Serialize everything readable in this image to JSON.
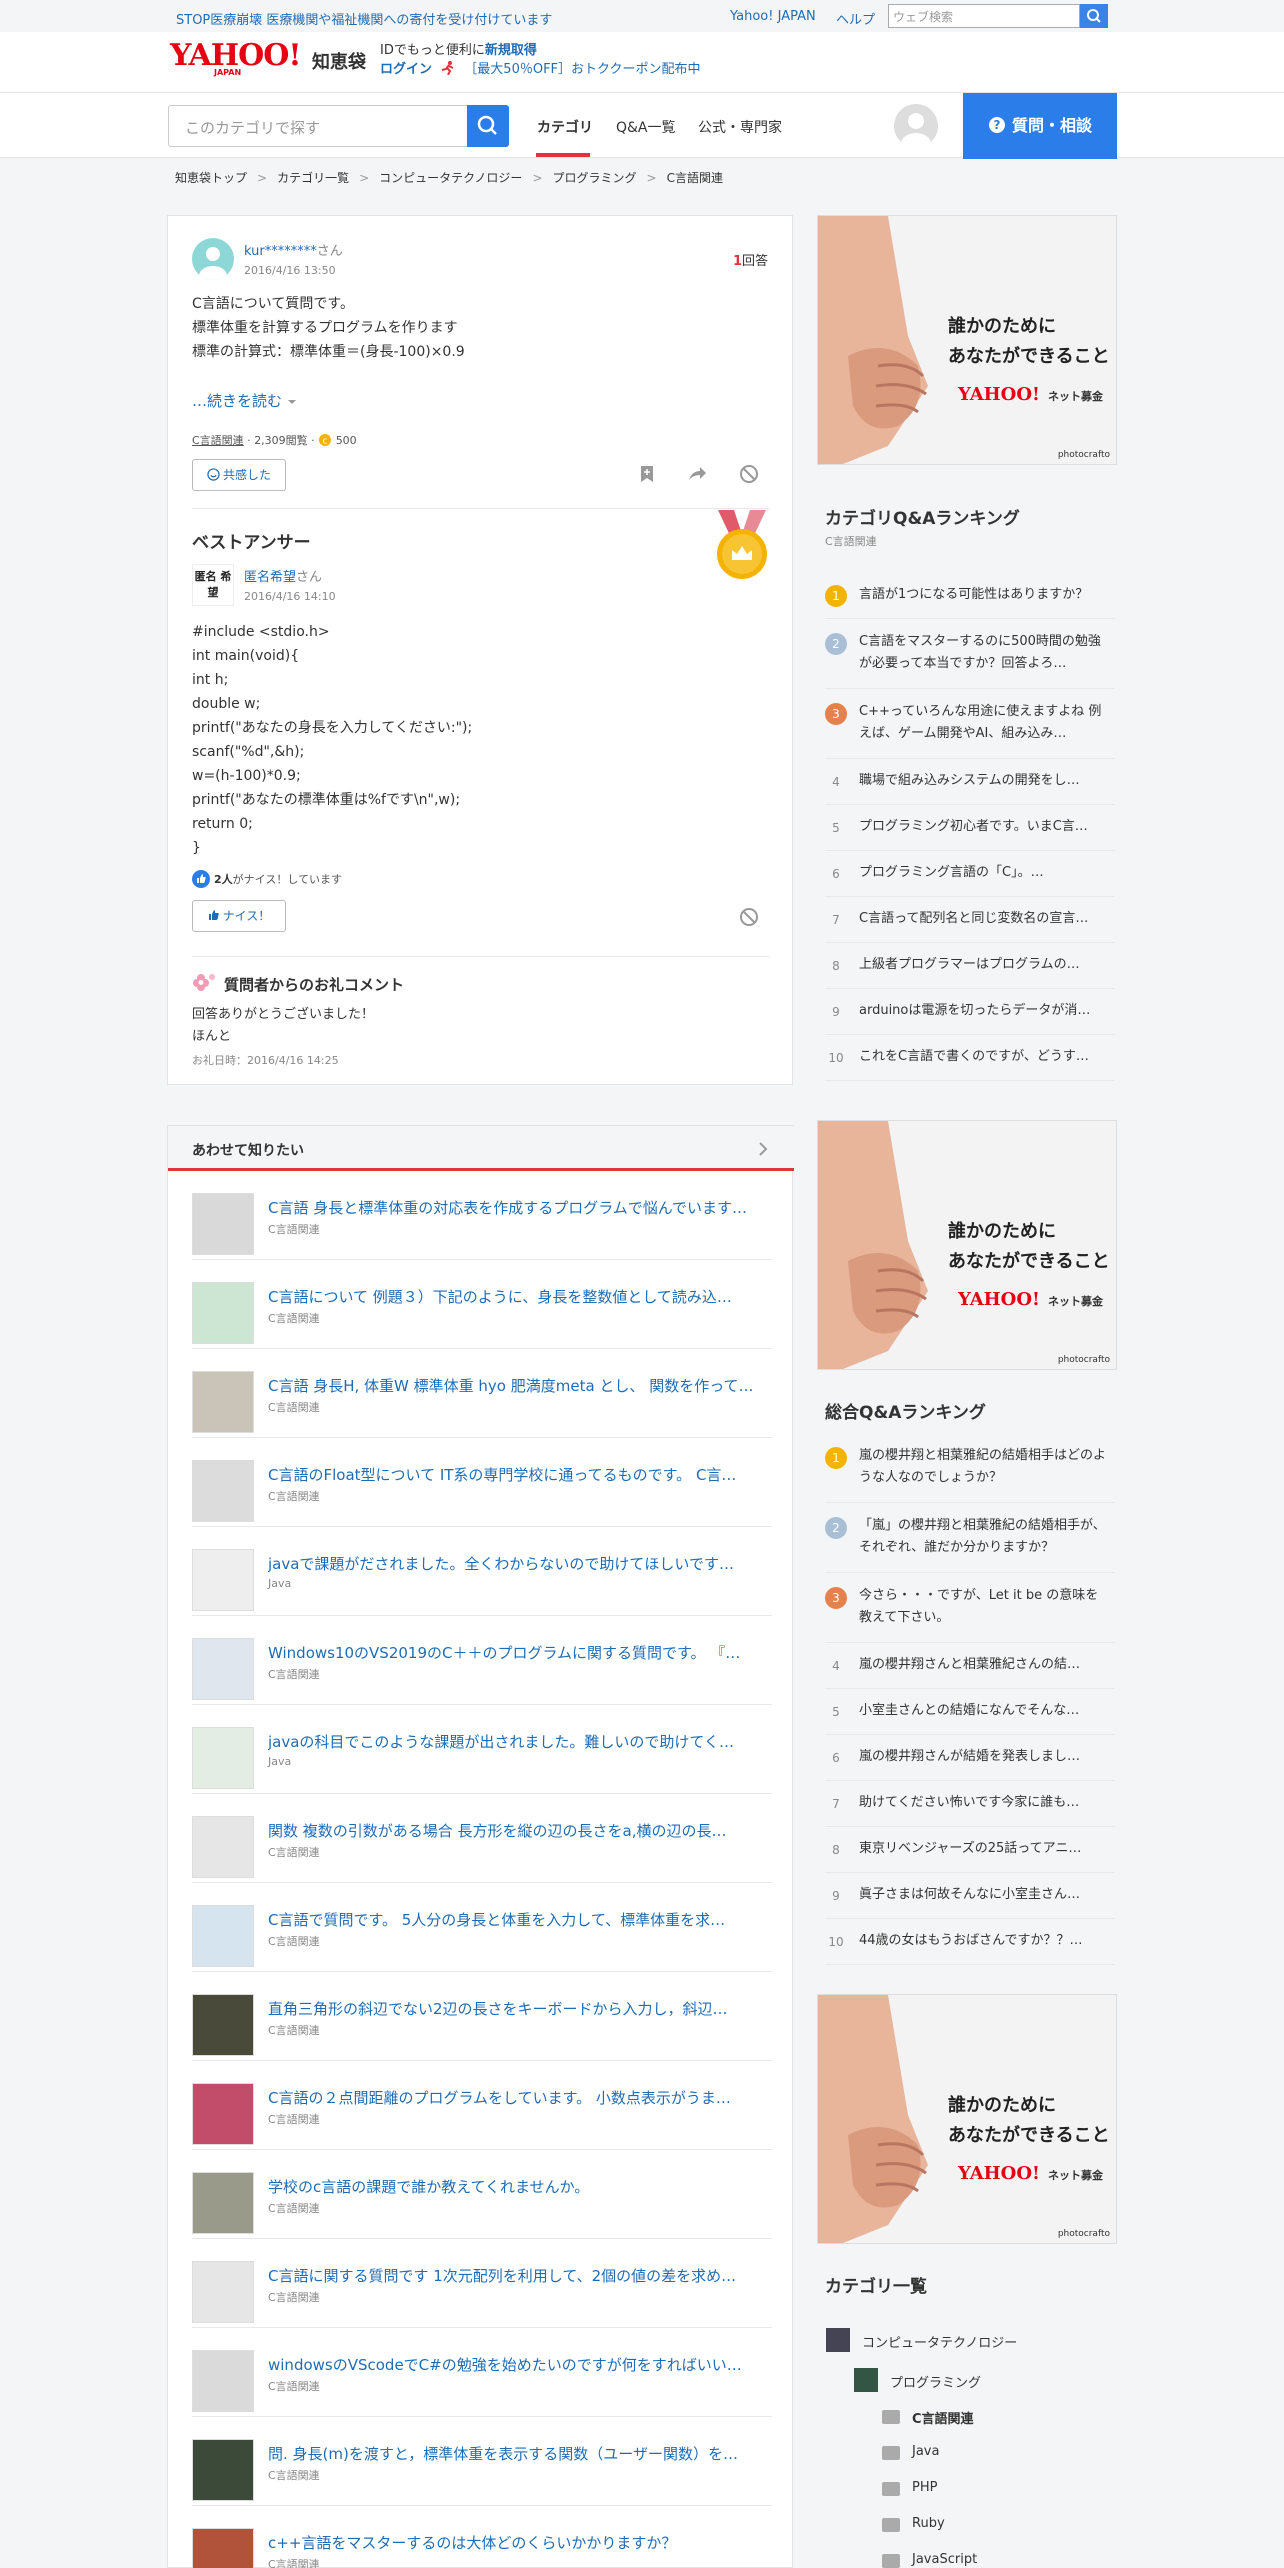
{
  "top_strip": {
    "notice": "STOP医療崩壊 医療機関や福祉機関への寄付を受け付けています",
    "yahoo_japan": "Yahoo! JAPAN",
    "help": "ヘルプ",
    "search_placeholder": "ウェブ検索"
  },
  "header": {
    "logo_main": "YAHOO!",
    "logo_sub": "JAPAN",
    "logo_service": "知恵袋",
    "promo_line1_a": "IDでもっと便利に",
    "promo_line1_b": "新規取得",
    "promo_line2_a": "ログイン",
    "promo_line2_b": "［最大50％OFF］おトククーポン配布中"
  },
  "nav": {
    "search_placeholder": "このカテゴリで探す",
    "tabs": [
      "カテゴリ",
      "Q&A一覧",
      "公式・専門家"
    ],
    "ask_button": "質問・相談"
  },
  "breadcrumb": [
    "知恵袋トップ",
    "カテゴリ一覧",
    "コンピュータテクノロジー",
    "プログラミング",
    "C言語関連"
  ],
  "question": {
    "user": "kur********",
    "san": "さん",
    "date": "2016/4/16 13:50",
    "answers_count": "1",
    "answers_label": "回答",
    "lines": [
      "C言語について質問です。",
      "標準体重を計算するプログラムを作ります",
      "標準の計算式：標準体重＝(身長-100)×0.9"
    ],
    "read_more": "…続きを読む",
    "category": "C言語関連",
    "views": "2,309閲覧",
    "coins": "500",
    "empathy_button": "共感した"
  },
  "best_answer": {
    "heading": "ベストアンサー",
    "user": "匿名希望",
    "avatar_text": "匿名 希望",
    "san": "さん",
    "date": "2016/4/16 14:10",
    "code_lines": [
      "#include <stdio.h>",
      "int main(void){",
      "int h;",
      "double w;",
      "printf(\"あなたの身長を入力してください:\");",
      "scanf(\"%d\",&h);",
      "w=(h-100)*0.9;",
      "printf(\"あなたの標準体重は%fです\\n\",w);",
      "return 0;",
      "}"
    ],
    "nice_count": "2人",
    "nice_text": "がナイス！しています",
    "nice_button": "ナイス！",
    "thanks_heading": "質問者からのお礼コメント",
    "thanks_lines": [
      "回答ありがとうございました！",
      "ほんと"
    ],
    "thanks_date": "お礼日時：2016/4/16 14:25"
  },
  "related": {
    "heading": "あわせて知りたい",
    "items": [
      {
        "title": "C言語 身長と標準体重の対応表を作成するプログラムで悩んでいます…",
        "category": "C言語関連"
      },
      {
        "title": "C言語について 例題３）下記のように、身長を整数値として読み込…",
        "category": "C言語関連"
      },
      {
        "title": "C言語 身長H, 体重W 標準体重 hyo 肥満度meta とし、 関数を作って…",
        "category": "C言語関連"
      },
      {
        "title": "C言語のFloat型について IT系の専門学校に通ってるものです。 C言…",
        "category": "C言語関連"
      },
      {
        "title": "javaで課題がだされました。全くわからないので助けてほしいです…",
        "category": "Java"
      },
      {
        "title": "Windows10のVS2019のC＋＋のプログラムに関する質問です。 『…",
        "category": "C言語関連"
      },
      {
        "title": "javaの科目でこのような課題が出されました。難しいので助けてく…",
        "category": "Java"
      },
      {
        "title": "関数 複数の引数がある場合 長方形を縦の辺の長さをa,横の辺の長…",
        "category": "C言語関連"
      },
      {
        "title": "C言語で質問です。 5人分の身長と体重を入力して、標準体重を求…",
        "category": "C言語関連"
      },
      {
        "title": "直角三角形の斜辺でない2辺の長さをキーボードから入力し，斜辺…",
        "category": "C言語関連"
      },
      {
        "title": "C言語の２点間距離のプログラムをしています。 小数点表示がうま…",
        "category": "C言語関連"
      },
      {
        "title": "学校のc言語の課題で誰か教えてくれませんか。",
        "category": "C言語関連"
      },
      {
        "title": "C言語に関する質問です 1次元配列を利用して、2個の値の差を求め…",
        "category": "C言語関連"
      },
      {
        "title": "windowsのVScodeでC#の勉強を始めたいのですが何をすればいい…",
        "category": "C言語関連"
      },
      {
        "title": "問. 身長(m)を渡すと，標準体重を表示する関数（ユーザー関数）を…",
        "category": "C言語関連"
      },
      {
        "title": "c++言語をマスターするのは大体どのくらいかかりますか？",
        "category": "C言語関連"
      }
    ]
  },
  "ad": {
    "line1": "誰かのために",
    "line2": "あなたができること",
    "brand": "YAHOO!",
    "brand_sub": "ネット募金",
    "credit": "photocrafto"
  },
  "category_ranking": {
    "heading": "カテゴリQ&Aランキング",
    "sub": "C言語関連",
    "items": [
      "言語が1つになる可能性はありますか？",
      "C言語をマスターするのに500時間の勉強が必要って本当ですか？回答よろ…",
      "C++っていろんな用途に使えますよね 例えば、ゲーム開発やAI、組み込み…",
      "職場で組み込みシステムの開発をし…",
      "プログラミング初心者です。いまC言…",
      "プログラミング言語の「C」。…",
      "C言語って配列名と同じ変数名の宣言…",
      "上級者プログラマーはプログラムの…",
      "arduinoは電源を切ったらデータが消…",
      "これをC言語で書くのですが、どうす…"
    ]
  },
  "overall_ranking": {
    "heading": "総合Q&Aランキング",
    "items": [
      "嵐の櫻井翔と相葉雅紀の結婚相手はどのような人なのでしょうか？",
      "「嵐」の櫻井翔と相葉雅紀の結婚相手が、それぞれ、誰だか分かりますか？",
      "今さら・・・ですが、Let it be の意味を教えて下さい。",
      "嵐の櫻井翔さんと相葉雅紀さんの結…",
      "小室圭さんとの結婚になんでそんな…",
      "嵐の櫻井翔さんが結婚を発表しまし…",
      "助けてください怖いです今家に誰も…",
      "東京リベンジャーズの25話ってアニ…",
      "眞子さまは何故そんなに小室圭さん…",
      "44歳の女はもうおばさんですか？？…"
    ]
  },
  "category_list": {
    "heading": "カテゴリ一覧",
    "level1": "コンピュータテクノロジー",
    "level2": "プログラミング",
    "level3": [
      "C言語関連",
      "Java",
      "PHP",
      "Ruby",
      "JavaScript"
    ]
  },
  "colors": {
    "accent_blue": "#2b7de9",
    "link_blue": "#1f6cb6",
    "accent_red": "#e2333a",
    "rank_gold": "#f5b301",
    "rank_silver": "#a9bfd6",
    "rank_bronze": "#e5814c"
  }
}
